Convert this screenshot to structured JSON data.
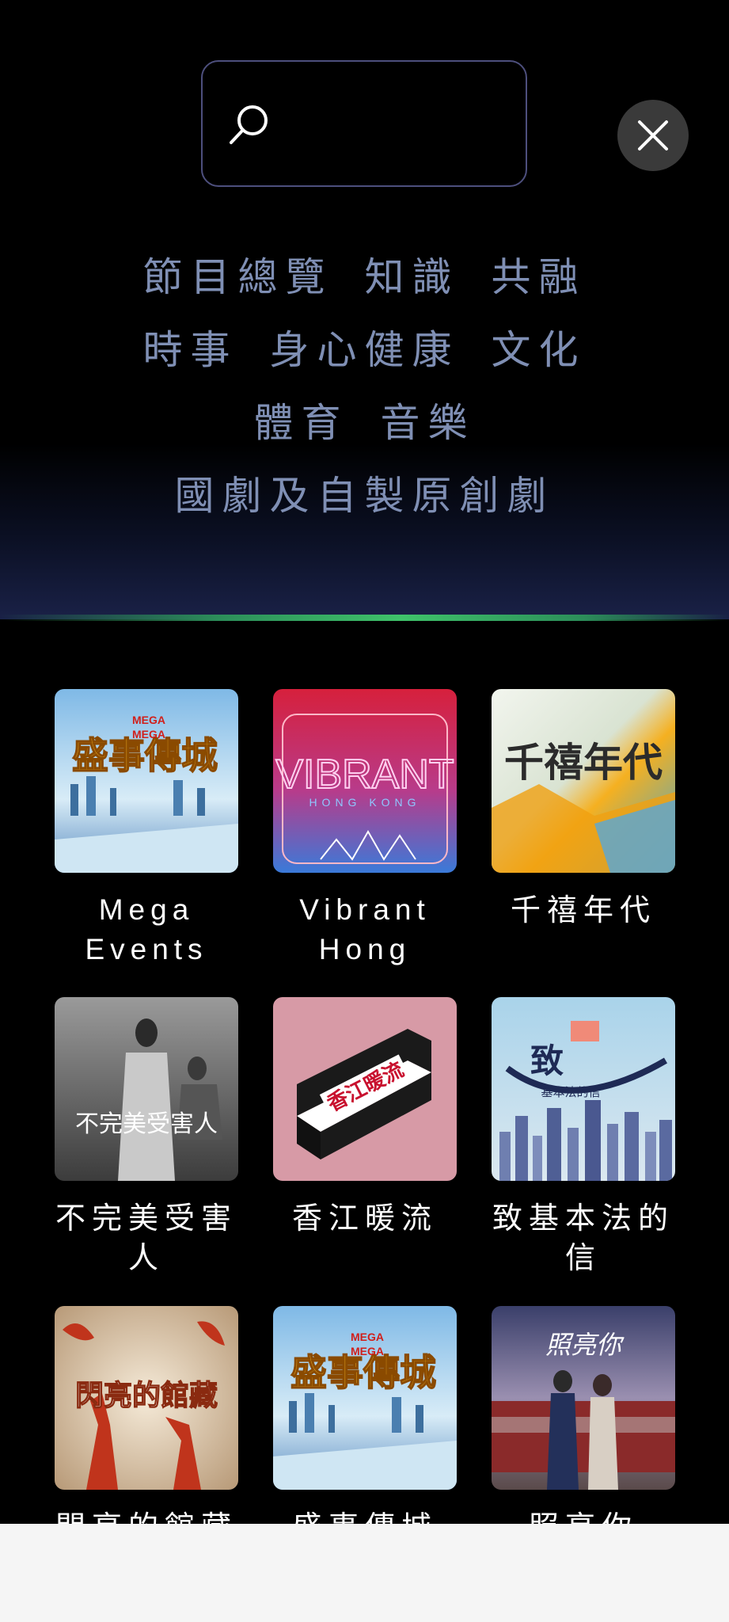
{
  "search": {
    "placeholder": ""
  },
  "categories": [
    [
      "節目總覽",
      "知識",
      "共融"
    ],
    [
      "時事",
      "身心健康",
      "文化"
    ],
    [
      "體育",
      "音樂"
    ],
    [
      "國劇及自製原創劇"
    ]
  ],
  "programs": [
    {
      "title": "Mega\nEvents",
      "thumb_text": "盛事傳城",
      "thumb_sub": "MEGA EVENTS MEGA HONG KONG"
    },
    {
      "title": "Vibrant\nHong",
      "thumb_text": "VIBRANT",
      "thumb_sub": "HONG KONG"
    },
    {
      "title": "千禧年代",
      "thumb_text": "千禧年代"
    },
    {
      "title": "不完美受害\n人",
      "thumb_text": "不完美受害人"
    },
    {
      "title": "香江暖流",
      "thumb_text": "香江暖流"
    },
    {
      "title": "致基本法的\n信",
      "thumb_text": "致",
      "thumb_sub": "基本法的信"
    },
    {
      "title": "閃亮的館藏",
      "thumb_text": "閃亮的館藏"
    },
    {
      "title": "盛事傳城",
      "thumb_text": "盛事傳城",
      "thumb_sub": "MEGA EVENTS MEGA HONG KONG"
    },
    {
      "title": "照亮你",
      "thumb_text": "照亮你"
    }
  ]
}
